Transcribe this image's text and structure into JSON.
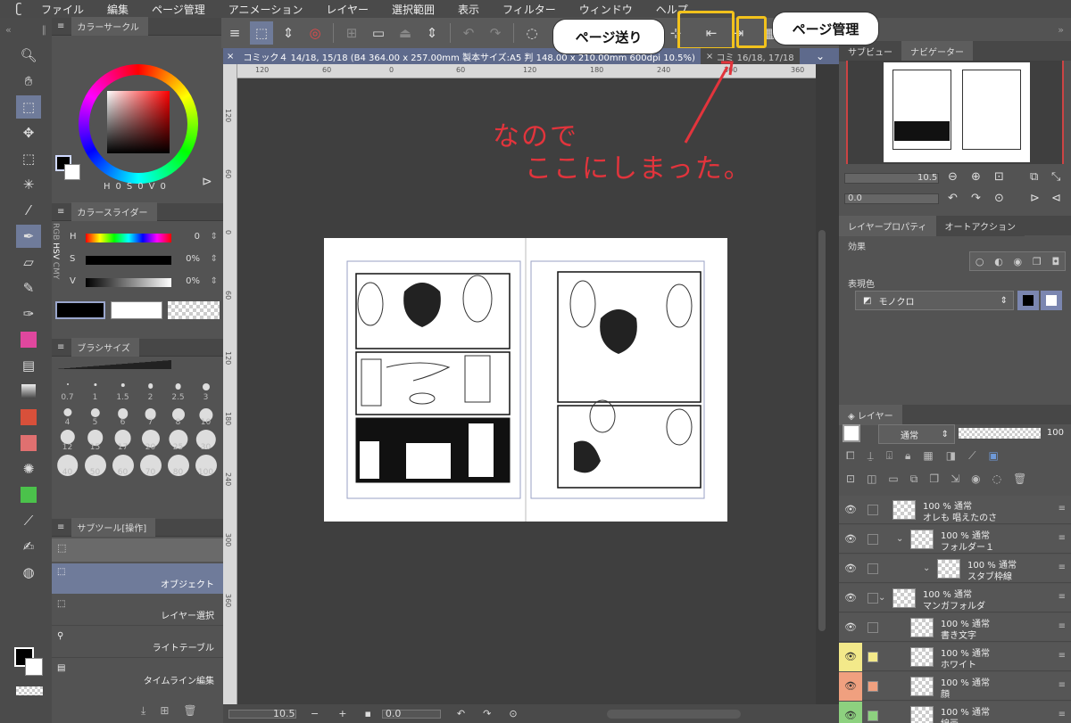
{
  "menubar": {
    "items": [
      "ファイル",
      "編集",
      "ページ管理",
      "アニメーション",
      "レイヤー",
      "選択範囲",
      "表示",
      "フィルター",
      "ウィンドウ",
      "ヘルプ"
    ]
  },
  "document": {
    "tab_active": "コミック４ 14/18, 15/18 (B4 364.00 x 257.00mm 製本サイズ:A5 判 148.00 x 210.00mm 600dpi 10.5%)",
    "tab_other": "コミ 16/18, 17/18"
  },
  "ruler": {
    "h_ticks": [
      "120",
      "60",
      "0",
      "60",
      "120",
      "180",
      "240",
      "300",
      "360"
    ],
    "v_ticks": [
      "120",
      "60",
      "0",
      "60",
      "120",
      "180",
      "240",
      "300",
      "360"
    ]
  },
  "left": {
    "color_circle_tab": "カラーサークル",
    "hsv_readout": {
      "h": "H",
      "h_val": "0",
      "s": "S",
      "s_val": "0",
      "v": "V",
      "v_val": "0"
    },
    "color_slider_tab": "カラースライダー",
    "slider_modes": [
      "RGB",
      "HSV",
      "CMY"
    ],
    "sliders": [
      {
        "label": "H",
        "value": "0"
      },
      {
        "label": "S",
        "value": "0%"
      },
      {
        "label": "V",
        "value": "0%"
      }
    ],
    "brush_size_tab": "ブラシサイズ",
    "brush_sizes": [
      "0.7",
      "1",
      "1.5",
      "2",
      "2.5",
      "3",
      "4",
      "5",
      "6",
      "7",
      "8",
      "10",
      "12",
      "15",
      "17",
      "20",
      "25",
      "30",
      "40",
      "50",
      "60",
      "70",
      "80",
      "100"
    ],
    "subtool_tab": "サブツール[操作]",
    "subtools": [
      "オブジェクト",
      "レイヤー選択",
      "ライトテーブル",
      "タイムライン編集"
    ]
  },
  "status": {
    "zoom": "10.5",
    "rotate": "0.0"
  },
  "right": {
    "nav_tabs": [
      "サブビュー",
      "ナビゲーター"
    ],
    "nav_zoom": "10.5",
    "nav_angle": "0.0",
    "layer_prop_tabs": [
      "レイヤープロパティ",
      "オートアクション"
    ],
    "effect_label": "効果",
    "expression_label": "表現色",
    "expression_value": "モノクロ",
    "layer_tab": "レイヤー",
    "blend_mode": "通常",
    "opacity": "100",
    "layers": [
      {
        "pct": "100 %",
        "mode": "通常",
        "name": "オレも 唱えたのさ"
      },
      {
        "pct": "100 %",
        "mode": "通常",
        "name": "フォルダー１"
      },
      {
        "pct": "100 %",
        "mode": "通常",
        "name": "スタブ枠線"
      },
      {
        "pct": "100 %",
        "mode": "通常",
        "name": "マンガフォルダ"
      },
      {
        "pct": "100 %",
        "mode": "通常",
        "name": "書き文字"
      },
      {
        "pct": "100 %",
        "mode": "通常",
        "name": "ホワイト"
      },
      {
        "pct": "100 %",
        "mode": "通常",
        "name": "顔"
      },
      {
        "pct": "100 %",
        "mode": "通常",
        "name": "線画"
      }
    ],
    "layer_colors": [
      "",
      "",
      "",
      "",
      "",
      "#f3e98a",
      "#f0a07f",
      "#8dd17f"
    ]
  },
  "annotations": {
    "bubble_page_turn": "ページ送り",
    "bubble_page_manage": "ページ管理",
    "red_line1": "なので",
    "red_line2": "ここにしまった。"
  },
  "colors": {
    "highlight": "#f2c21c",
    "annotation_red": "#e2343c",
    "accent": "#6f7b9a"
  }
}
